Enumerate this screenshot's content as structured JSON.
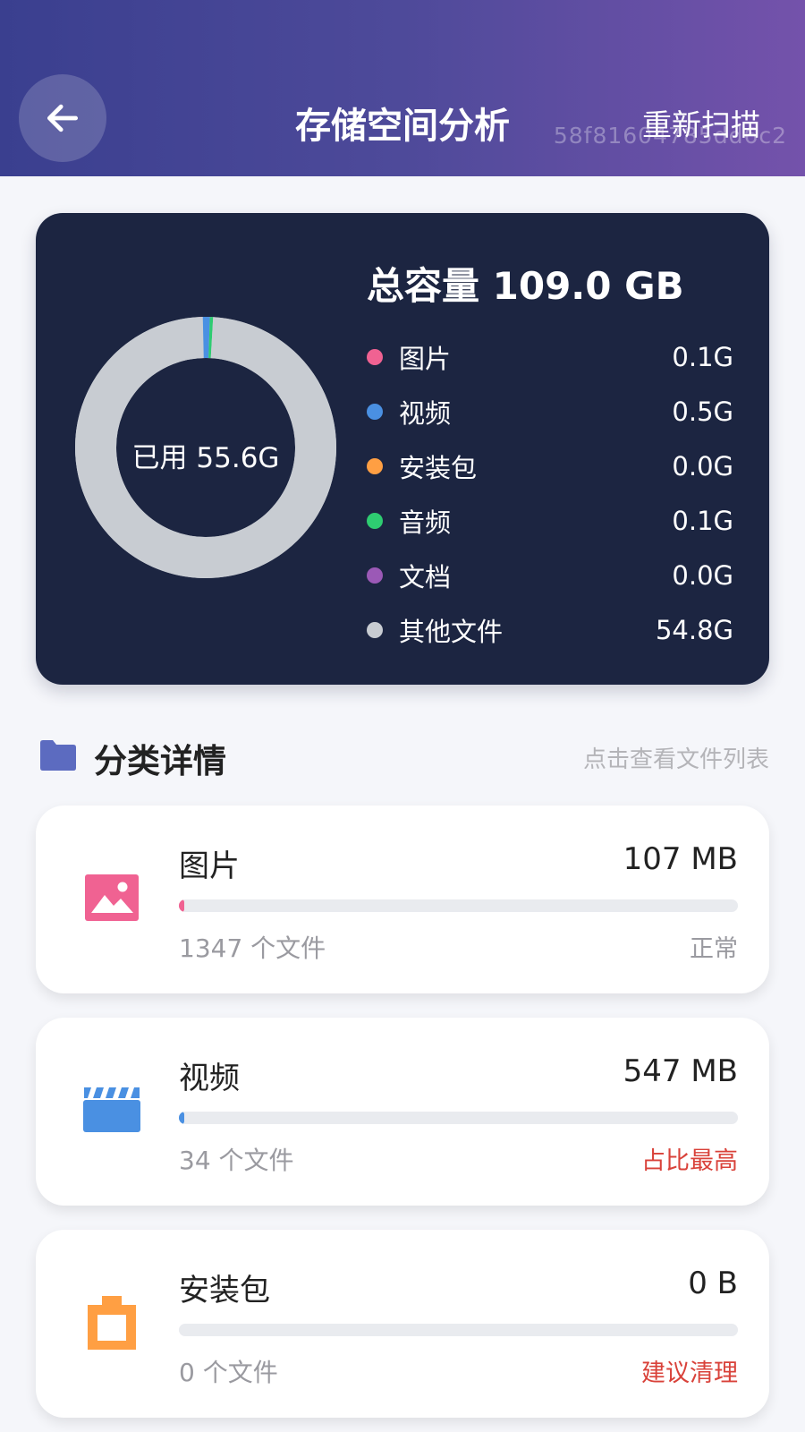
{
  "header": {
    "title": "存储空间分析",
    "rescan_label": "重新扫描",
    "watermark": "58f81604785dd6c2"
  },
  "summary": {
    "total_label": "总容量 109.0 GB",
    "used_label": "已用 55.6G",
    "legend": [
      {
        "label": "图片",
        "value": "0.1G",
        "color": "#f06292"
      },
      {
        "label": "视频",
        "value": "0.5G",
        "color": "#4a90e2"
      },
      {
        "label": "安装包",
        "value": "0.0G",
        "color": "#ff9f43"
      },
      {
        "label": "音频",
        "value": "0.1G",
        "color": "#2ecc71"
      },
      {
        "label": "文档",
        "value": "0.0G",
        "color": "#9b59b6"
      },
      {
        "label": "其他文件",
        "value": "54.8G",
        "color": "#c8ccd2"
      }
    ],
    "donut_values": [
      0.1,
      0.5,
      0.0,
      0.1,
      0.0,
      54.8
    ]
  },
  "section": {
    "title": "分类详情",
    "hint": "点击查看文件列表"
  },
  "categories": [
    {
      "name": "图片",
      "size": "107 MB",
      "count": "1347 个文件",
      "status": "正常",
      "status_color": "#9a9aa0",
      "icon": "image-icon",
      "icon_color": "#f06292",
      "fill": 0.01
    },
    {
      "name": "视频",
      "size": "547 MB",
      "count": "34 个文件",
      "status": "占比最高",
      "status_color": "#d9423a",
      "icon": "video-icon",
      "icon_color": "#4a90e2",
      "fill": 0.01
    },
    {
      "name": "安装包",
      "size": "0 B",
      "count": "0 个文件",
      "status": "建议清理",
      "status_color": "#d9423a",
      "icon": "package-icon",
      "icon_color": "#ff9f43",
      "fill": 0
    }
  ]
}
